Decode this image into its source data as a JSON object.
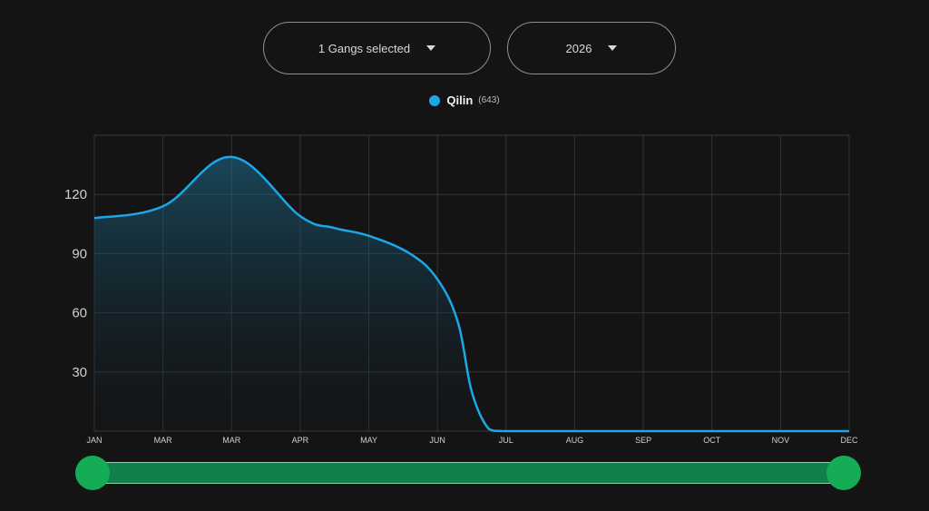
{
  "filters": {
    "gangs_label": "1 Gangs selected",
    "year_label": "2026"
  },
  "legend": {
    "name": "Qilin",
    "count": "(643)",
    "color": "#1ea7e8"
  },
  "colors": {
    "background": "#141414",
    "line": "#1ea7e8",
    "slider_track": "#12804a",
    "slider_handle": "#14ad55"
  },
  "chart_data": {
    "type": "area",
    "title": "",
    "xlabel": "",
    "ylabel": "",
    "x_tick_labels": [
      "JAN",
      "MAR",
      "MAR",
      "APR",
      "MAY",
      "JUN",
      "JUL",
      "AUG",
      "SEP",
      "OCT",
      "NOV",
      "DEC"
    ],
    "y_ticks": [
      30,
      60,
      90,
      120
    ],
    "ylim": [
      0,
      150
    ],
    "grid": true,
    "legend_position": "top-center",
    "series": [
      {
        "name": "Qilin",
        "color": "#1ea7e8",
        "smooth": true,
        "points": [
          {
            "x": 0,
            "y": 108
          },
          {
            "x": 1,
            "y": 114
          },
          {
            "x": 2,
            "y": 139
          },
          {
            "x": 3,
            "y": 109
          },
          {
            "x": 3.5,
            "y": 103
          },
          {
            "x": 4,
            "y": 99
          },
          {
            "x": 4.6,
            "y": 90
          },
          {
            "x": 5,
            "y": 77
          },
          {
            "x": 5.3,
            "y": 55
          },
          {
            "x": 5.5,
            "y": 20
          },
          {
            "x": 5.75,
            "y": 1
          },
          {
            "x": 6,
            "y": 0
          },
          {
            "x": 7,
            "y": 0
          },
          {
            "x": 8,
            "y": 0
          },
          {
            "x": 9,
            "y": 0
          },
          {
            "x": 10,
            "y": 0
          },
          {
            "x": 11,
            "y": 0
          }
        ]
      }
    ]
  },
  "range_slider": {
    "start": 0,
    "end": 1
  }
}
